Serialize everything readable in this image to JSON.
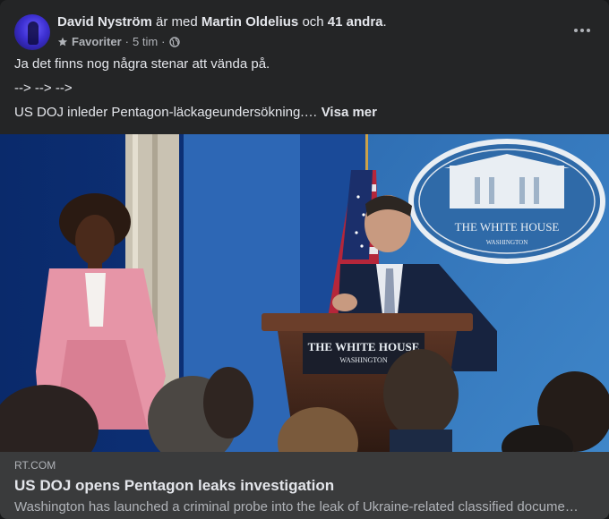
{
  "post": {
    "author": "David Nyström",
    "with_text": "är med",
    "tagged": "Martin Oldelius",
    "and_text": "och",
    "others": "41 andra",
    "period": ".",
    "favorite_label": "Favoriter",
    "time": "5 tim",
    "separator": "·",
    "text_lines": [
      "Ja det finns nog några stenar att vända på.",
      "--> --> -->",
      "US DOJ inleder Pentagon-läckageundersökning.…"
    ],
    "see_more": "Visa mer"
  },
  "image": {
    "sign_top": "THE WHITE HOUSE",
    "sign_bottom": "WASHINGTON",
    "podium_top": "THE WHITE HOUSE",
    "podium_bottom": "WASHINGTON"
  },
  "link": {
    "domain": "RT.COM",
    "title": "US DOJ opens Pentagon leaks investigation",
    "description": "Washington has launched a criminal probe into the leak of Ukraine-related classified docume…"
  },
  "colors": {
    "card_bg": "#242526",
    "link_bg": "#3a3b3c",
    "text_primary": "#e4e6eb",
    "text_secondary": "#b0b3b8"
  },
  "icons": [
    "star-icon",
    "globe-icon",
    "more-icon"
  ]
}
